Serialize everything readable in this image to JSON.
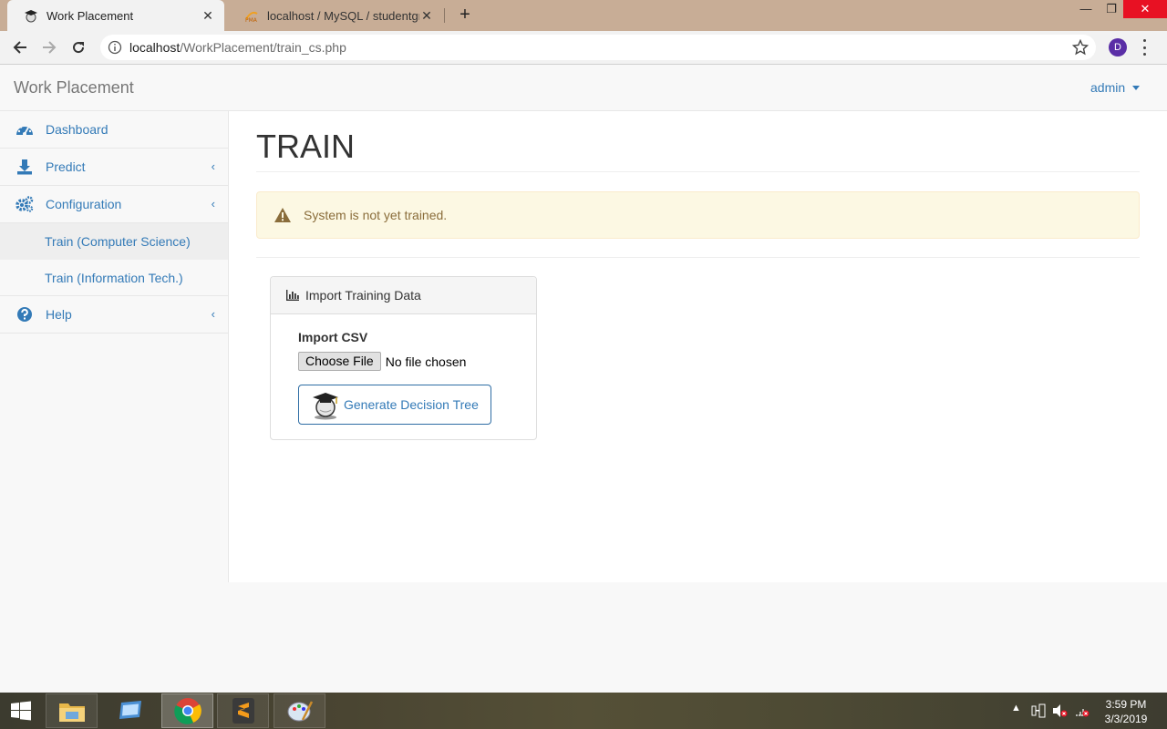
{
  "browser": {
    "tabs": [
      {
        "title": "Work Placement",
        "active": true
      },
      {
        "title": "localhost / MySQL / studentgrad",
        "active": false
      }
    ],
    "url_host": "localhost",
    "url_path": "/WorkPlacement/train_cs.php",
    "profile_initial": "D",
    "icons": [
      "back-arrow-icon",
      "forward-arrow-icon",
      "reload-icon",
      "info-icon",
      "star-icon",
      "menu-dots-icon"
    ]
  },
  "navbar": {
    "brand": "Work Placement",
    "user": "admin"
  },
  "sidebar": {
    "items": [
      {
        "label": "Dashboard",
        "icon": "dashboard-icon"
      },
      {
        "label": "Predict",
        "icon": "download-icon"
      },
      {
        "label": "Configuration",
        "icon": "gears-icon"
      },
      {
        "label": "Help",
        "icon": "question-icon"
      }
    ],
    "sub_items": [
      {
        "label": "Train (Computer Science)",
        "active": true
      },
      {
        "label": "Train (Information Tech.)",
        "active": false
      }
    ]
  },
  "main": {
    "title": "TRAIN",
    "alert": "System is not yet trained.",
    "panel": {
      "heading": "Import Training Data",
      "import_label": "Import CSV",
      "choose_file": "Choose File",
      "file_status": "No file chosen",
      "generate_button": "Generate Decision Tree"
    }
  },
  "taskbar": {
    "time": "3:59 PM",
    "date": "3/3/2019",
    "apps": [
      "file-explorer-icon",
      "desktop-icon",
      "chrome-icon",
      "sublime-icon",
      "paint-icon"
    ]
  },
  "colors": {
    "link": "#337ab7",
    "alert_bg": "#fcf8e3",
    "alert_text": "#8a6d3b",
    "tabbar": "#c8ad96"
  }
}
